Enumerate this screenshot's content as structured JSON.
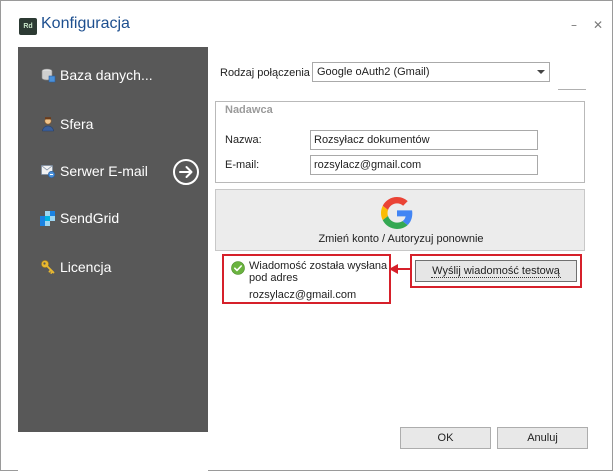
{
  "window": {
    "title": "Konfiguracja",
    "app_icon_text": "Rd",
    "minimize_symbol": "–",
    "close_symbol": "✕"
  },
  "sidebar": {
    "items": [
      {
        "label": "Baza danych...",
        "icon": "database-icon"
      },
      {
        "label": "Sfera",
        "icon": "user-icon"
      },
      {
        "label": "Serwer E-mail",
        "icon": "email-server-icon",
        "active": true
      },
      {
        "label": "SendGrid",
        "icon": "sendgrid-icon"
      },
      {
        "label": "Licencja",
        "icon": "key-icon"
      }
    ]
  },
  "connection": {
    "label": "Rodzaj połączenia",
    "selected": "Google oAuth2 (Gmail)"
  },
  "sender": {
    "group_title": "Nadawca",
    "name_label": "Nazwa:",
    "name_value": "Rozsyłacz dokumentów",
    "email_label": "E-mail:",
    "email_value": "rozsylacz@gmail.com"
  },
  "google": {
    "button_label": "Zmień konto / Autoryzuj ponownie",
    "icon": "google-g-icon"
  },
  "status": {
    "message_line1": "Wiadomość została wysłana",
    "message_line2": "pod adres",
    "email": "rozsylacz@gmail.com"
  },
  "test_button": {
    "label": "Wyślij wiadomość testową"
  },
  "footer": {
    "ok_label": "OK",
    "cancel_label": "Anuluj"
  },
  "colors": {
    "accent_title": "#1d4f8f",
    "sidebar_bg": "#585858",
    "highlight_red": "#d6202a",
    "success_green": "#6ab33f"
  }
}
